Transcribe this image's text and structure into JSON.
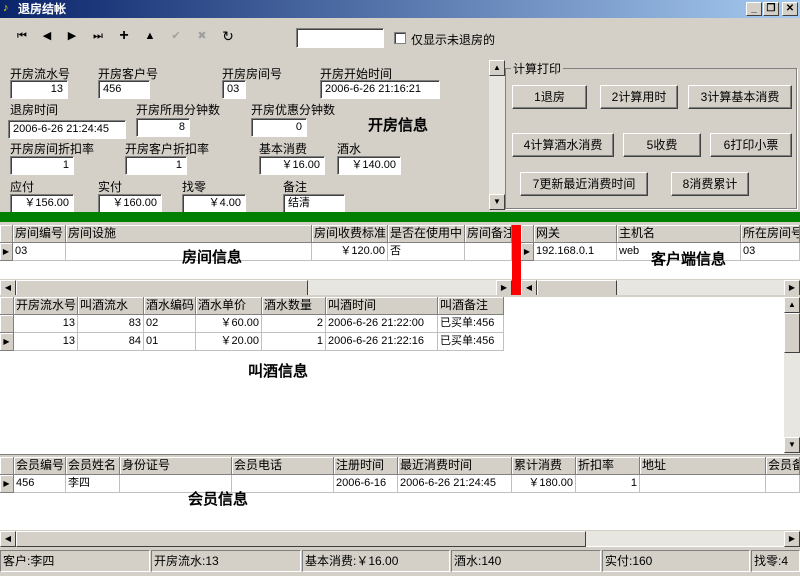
{
  "window": {
    "title": "退房结帐",
    "app_icon": "music-note-icon"
  },
  "toolbar": {
    "buttons": [
      "first-record-icon",
      "prev-record-icon",
      "next-record-icon",
      "last-record-icon",
      "insert-record-icon",
      "delete-record-icon",
      "post-record-icon",
      "cancel-edit-icon",
      "refresh-icon"
    ],
    "search_value": "",
    "checkbox_label": "仅显示未退房的",
    "checkbox_checked": false
  },
  "open_info": {
    "section_title": "开房信息",
    "labels": {
      "serial": "开房流水号",
      "customer": "开房客户号",
      "room": "开房房间号",
      "start": "开房开始时间",
      "checkout_time": "退房时间",
      "minutes_used": "开房所用分钟数",
      "discount_minutes": "开房优惠分钟数",
      "room_discount": "开房房间折扣率",
      "customer_discount": "开房客户折扣率",
      "base_cost": "基本消费",
      "wine": "酒水",
      "payable": "应付",
      "paid": "实付",
      "change": "找零",
      "note": "备注"
    },
    "values": {
      "serial": "13",
      "customer": "456",
      "room": "03",
      "start": "2006-6-26 21:16:21",
      "checkout_time": "2006-6-26 21:24:45",
      "minutes_used": "8",
      "discount_minutes": "0",
      "room_discount": "1",
      "customer_discount": "1",
      "base_cost": "￥16.00",
      "wine": "￥140.00",
      "payable": "￥156.00",
      "paid": "￥160.00",
      "change": "￥4.00",
      "note": "结清"
    }
  },
  "calc": {
    "group_title": "计算打印",
    "buttons": [
      "1退房",
      "2计算用时",
      "3计算基本消费",
      "4计算酒水消费",
      "5收费",
      "6打印小票",
      "7更新最近消费时间",
      "8消费累计"
    ]
  },
  "room_grid": {
    "label": "房间信息",
    "columns": [
      "房间编号",
      "房间设施",
      "房间收费标准",
      "是否在使用中",
      "房间备注"
    ],
    "rows": [
      [
        "03",
        "",
        "￥120.00",
        "否",
        ""
      ]
    ]
  },
  "client_grid": {
    "label": "客户端信息",
    "columns": [
      "网关",
      "主机名",
      "所在房间号"
    ],
    "rows": [
      [
        "192.168.0.1",
        "web",
        "03"
      ]
    ]
  },
  "wine_grid": {
    "label": "叫酒信息",
    "columns": [
      "开房流水号",
      "叫酒流水",
      "酒水编码",
      "酒水单价",
      "酒水数量",
      "叫酒时间",
      "叫酒备注"
    ],
    "rows": [
      [
        "13",
        "83",
        "02",
        "￥60.00",
        "2",
        "2006-6-26 21:22:00",
        "已买单:456"
      ],
      [
        "13",
        "84",
        "01",
        "￥20.00",
        "1",
        "2006-6-26 21:22:16",
        "已买单:456"
      ]
    ]
  },
  "member_grid": {
    "label": "会员信息",
    "columns": [
      "会员编号",
      "会员姓名",
      "身份证号",
      "会员电话",
      "注册时间",
      "最近消费时间",
      "累计消费",
      "折扣率",
      "地址",
      "会员备注"
    ],
    "rows": [
      [
        "456",
        "李四",
        "",
        "",
        "2006-6-16",
        "2006-6-26 21:24:45",
        "￥180.00",
        "1",
        "",
        ""
      ]
    ]
  },
  "statusbar": [
    "客户:李四",
    "开房流水:13",
    "基本消费:￥16.00",
    "酒水:140",
    "实付:160",
    "找零:4"
  ],
  "colors": {
    "splitter_green": "#008000",
    "splitter_red": "#ff0000",
    "titlebar": "#0a246a"
  }
}
